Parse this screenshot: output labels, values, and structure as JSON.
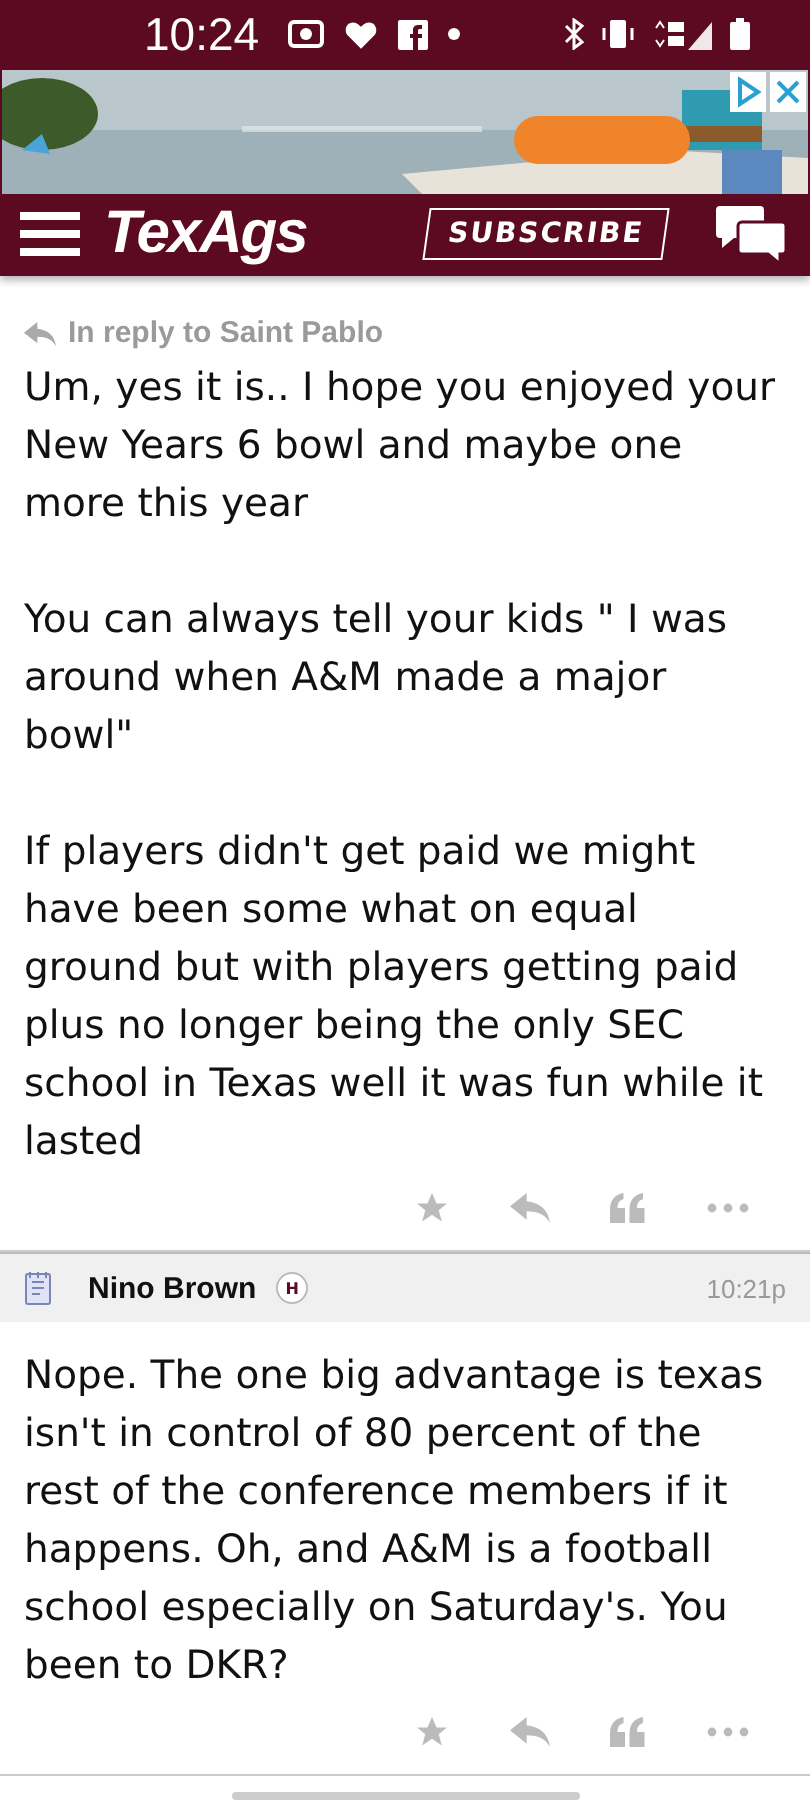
{
  "status_bar": {
    "time": "10:24"
  },
  "header": {
    "logo": "TexAgs",
    "subscribe": "SUBSCRIBE"
  },
  "posts": [
    {
      "kind": "reply",
      "reply_to": "In reply to Saint Pablo",
      "paragraphs": [
        "Um, yes it is.. I hope you enjoyed your New Years 6 bowl and maybe one more this year",
        "You can always tell your kids \" I was around when A&M made a major bowl\"",
        "If players didn't get paid we might have been some what on equal ground but with players getting paid plus no longer being the only SEC school in Texas well it was fun while it lasted"
      ]
    },
    {
      "kind": "post",
      "author": "Nino Brown",
      "badge": "H",
      "time": "10:21p",
      "paragraphs": [
        "Nope. The one big advantage is texas isn't in control of 80 percent of the rest of the conference members if it happens. Oh, and A&M is a football school especially on Saturday's. You been to DKR?"
      ]
    }
  ]
}
